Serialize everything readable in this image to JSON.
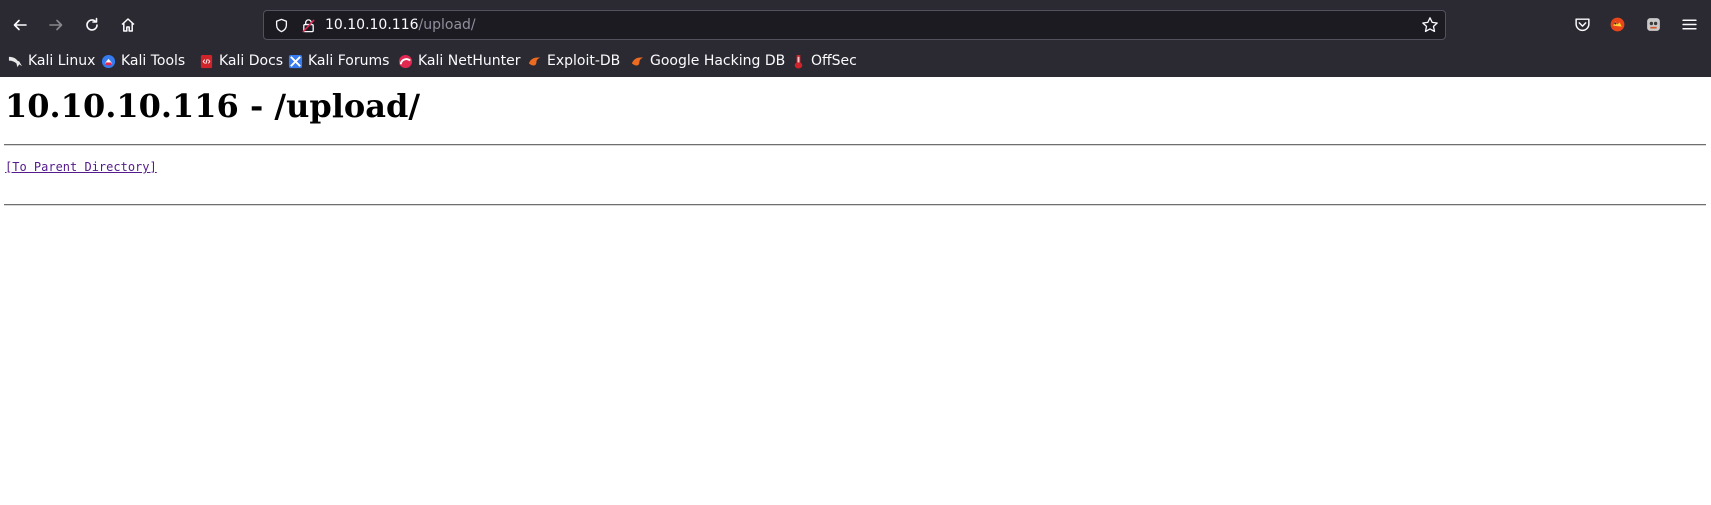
{
  "browser": {
    "url_host": "10.10.10.116",
    "url_path": "/upload/",
    "icons": {
      "back": "back-arrow-icon",
      "forward": "forward-arrow-icon",
      "reload": "reload-icon",
      "home": "home-icon",
      "shield": "tracking-protection-shield-icon",
      "lock": "insecure-lock-icon",
      "bookmark_star": "bookmark-star-icon",
      "pocket": "pocket-icon",
      "extension1": "extension-icon",
      "extension2": "extension-icon",
      "menu": "hamburger-menu-icon"
    }
  },
  "bookmarks": [
    {
      "label": "Kali Linux",
      "icon": "kali-dragon-icon"
    },
    {
      "label": "Kali Tools",
      "icon": "kali-tools-icon"
    },
    {
      "label": "Kali Docs",
      "icon": "kali-docs-icon"
    },
    {
      "label": "Kali Forums",
      "icon": "kali-forums-icon"
    },
    {
      "label": "Kali NetHunter",
      "icon": "nethunter-icon"
    },
    {
      "label": "Exploit-DB",
      "icon": "exploit-db-icon"
    },
    {
      "label": "Google Hacking DB",
      "icon": "ghdb-icon"
    },
    {
      "label": "OffSec",
      "icon": "offsec-icon"
    }
  ],
  "page": {
    "heading": "10.10.10.116 - /upload/",
    "parent_link": "[To Parent Directory]"
  },
  "colors": {
    "chrome_bg": "#2b2a33",
    "urlbar_bg": "#1c1b22",
    "visited_link": "#551a8b"
  }
}
